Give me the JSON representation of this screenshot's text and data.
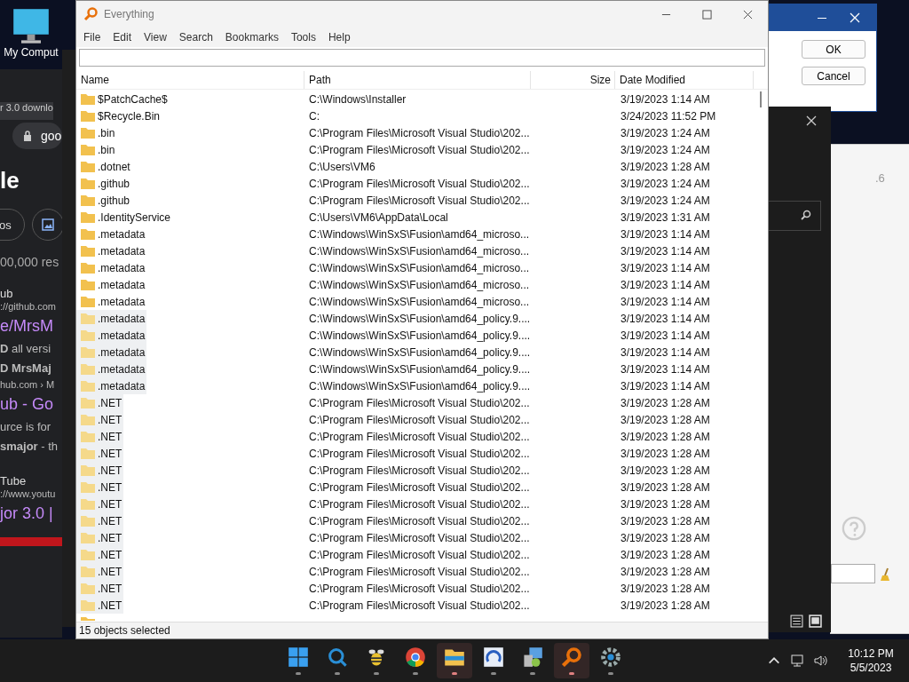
{
  "desktop_icon": {
    "label": "My Comput"
  },
  "browser_lines": [
    {
      "kind": "tab",
      "text": "r 3.0 downlo"
    },
    {
      "kind": "address",
      "text": "goo"
    },
    {
      "kind": "logo",
      "text": "le"
    },
    {
      "kind": "chip",
      "text": "os"
    },
    {
      "kind": "meta",
      "text": "00,000 res"
    },
    {
      "kind": "site",
      "text": "ub"
    },
    {
      "kind": "url",
      "text": "://github.com"
    },
    {
      "kind": "link",
      "text": "e/MrsM"
    },
    {
      "kind": "snippet",
      "text": "**D** all versi"
    },
    {
      "kind": "snippet",
      "text": "**D MrsMaj**"
    },
    {
      "kind": "url",
      "text": "hub.com › M"
    },
    {
      "kind": "link",
      "text": "ub - Go"
    },
    {
      "kind": "snippet",
      "text": "urce is for"
    },
    {
      "kind": "snippet",
      "text": "**smajor** - th"
    },
    {
      "kind": "site",
      "text": "Tube"
    },
    {
      "kind": "url",
      "text": "://www.youtu"
    },
    {
      "kind": "link",
      "text": "jor 3.0 |"
    }
  ],
  "window": {
    "title": "Everything"
  },
  "menu": [
    "File",
    "Edit",
    "View",
    "Search",
    "Bookmarks",
    "Tools",
    "Help"
  ],
  "columns": [
    "Name",
    "Path",
    "Size",
    "Date Modified"
  ],
  "rows": [
    {
      "name": "$PatchCache$",
      "path": "C:\\Windows\\Installer",
      "date": "3/19/2023 1:14 AM",
      "selected": false
    },
    {
      "name": "$Recycle.Bin",
      "path": "C:",
      "date": "3/24/2023 11:52 PM",
      "selected": false
    },
    {
      "name": ".bin",
      "path": "C:\\Program Files\\Microsoft Visual Studio\\202...",
      "date": "3/19/2023 1:24 AM",
      "selected": false
    },
    {
      "name": ".bin",
      "path": "C:\\Program Files\\Microsoft Visual Studio\\202...",
      "date": "3/19/2023 1:24 AM",
      "selected": false
    },
    {
      "name": ".dotnet",
      "path": "C:\\Users\\VM6",
      "date": "3/19/2023 1:28 AM",
      "selected": false
    },
    {
      "name": ".github",
      "path": "C:\\Program Files\\Microsoft Visual Studio\\202...",
      "date": "3/19/2023 1:24 AM",
      "selected": false
    },
    {
      "name": ".github",
      "path": "C:\\Program Files\\Microsoft Visual Studio\\202...",
      "date": "3/19/2023 1:24 AM",
      "selected": false
    },
    {
      "name": ".IdentityService",
      "path": "C:\\Users\\VM6\\AppData\\Local",
      "date": "3/19/2023 1:31 AM",
      "selected": false
    },
    {
      "name": ".metadata",
      "path": "C:\\Windows\\WinSxS\\Fusion\\amd64_microso...",
      "date": "3/19/2023 1:14 AM",
      "selected": false
    },
    {
      "name": ".metadata",
      "path": "C:\\Windows\\WinSxS\\Fusion\\amd64_microso...",
      "date": "3/19/2023 1:14 AM",
      "selected": false
    },
    {
      "name": ".metadata",
      "path": "C:\\Windows\\WinSxS\\Fusion\\amd64_microso...",
      "date": "3/19/2023 1:14 AM",
      "selected": false
    },
    {
      "name": ".metadata",
      "path": "C:\\Windows\\WinSxS\\Fusion\\amd64_microso...",
      "date": "3/19/2023 1:14 AM",
      "selected": false
    },
    {
      "name": ".metadata",
      "path": "C:\\Windows\\WinSxS\\Fusion\\amd64_microso...",
      "date": "3/19/2023 1:14 AM",
      "selected": false
    },
    {
      "name": ".metadata",
      "path": "C:\\Windows\\WinSxS\\Fusion\\amd64_policy.9....",
      "date": "3/19/2023 1:14 AM",
      "selected": true
    },
    {
      "name": ".metadata",
      "path": "C:\\Windows\\WinSxS\\Fusion\\amd64_policy.9....",
      "date": "3/19/2023 1:14 AM",
      "selected": true
    },
    {
      "name": ".metadata",
      "path": "C:\\Windows\\WinSxS\\Fusion\\amd64_policy.9....",
      "date": "3/19/2023 1:14 AM",
      "selected": true
    },
    {
      "name": ".metadata",
      "path": "C:\\Windows\\WinSxS\\Fusion\\amd64_policy.9....",
      "date": "3/19/2023 1:14 AM",
      "selected": true
    },
    {
      "name": ".metadata",
      "path": "C:\\Windows\\WinSxS\\Fusion\\amd64_policy.9....",
      "date": "3/19/2023 1:14 AM",
      "selected": true
    },
    {
      "name": ".NET",
      "path": "C:\\Program Files\\Microsoft Visual Studio\\202...",
      "date": "3/19/2023 1:28 AM",
      "selected": true
    },
    {
      "name": ".NET",
      "path": "C:\\Program Files\\Microsoft Visual Studio\\202...",
      "date": "3/19/2023 1:28 AM",
      "selected": true
    },
    {
      "name": ".NET",
      "path": "C:\\Program Files\\Microsoft Visual Studio\\202...",
      "date": "3/19/2023 1:28 AM",
      "selected": true
    },
    {
      "name": ".NET",
      "path": "C:\\Program Files\\Microsoft Visual Studio\\202...",
      "date": "3/19/2023 1:28 AM",
      "selected": true
    },
    {
      "name": ".NET",
      "path": "C:\\Program Files\\Microsoft Visual Studio\\202...",
      "date": "3/19/2023 1:28 AM",
      "selected": true
    },
    {
      "name": ".NET",
      "path": "C:\\Program Files\\Microsoft Visual Studio\\202...",
      "date": "3/19/2023 1:28 AM",
      "selected": true
    },
    {
      "name": ".NET",
      "path": "C:\\Program Files\\Microsoft Visual Studio\\202...",
      "date": "3/19/2023 1:28 AM",
      "selected": true
    },
    {
      "name": ".NET",
      "path": "C:\\Program Files\\Microsoft Visual Studio\\202...",
      "date": "3/19/2023 1:28 AM",
      "selected": true
    },
    {
      "name": ".NET",
      "path": "C:\\Program Files\\Microsoft Visual Studio\\202...",
      "date": "3/19/2023 1:28 AM",
      "selected": true
    },
    {
      "name": ".NET",
      "path": "C:\\Program Files\\Microsoft Visual Studio\\202...",
      "date": "3/19/2023 1:28 AM",
      "selected": true
    },
    {
      "name": ".NET",
      "path": "C:\\Program Files\\Microsoft Visual Studio\\202...",
      "date": "3/19/2023 1:28 AM",
      "selected": true
    },
    {
      "name": ".NET",
      "path": "C:\\Program Files\\Microsoft Visual Studio\\202...",
      "date": "3/19/2023 1:28 AM",
      "selected": true
    },
    {
      "name": ".NET",
      "path": "C:\\Program Files\\Microsoft Visual Studio\\202...",
      "date": "3/19/2023 1:28 AM",
      "selected": true
    }
  ],
  "status_bar": "15 objects selected",
  "dialog": {
    "buttons": [
      "OK",
      "Cancel"
    ]
  },
  "side_window": {
    "version": ".6"
  },
  "taskbar": {
    "apps": [
      {
        "kind": "start",
        "active": false
      },
      {
        "kind": "search",
        "active": false
      },
      {
        "kind": "bee",
        "active": false
      },
      {
        "kind": "chrome",
        "active": false
      },
      {
        "kind": "folder",
        "active": true
      },
      {
        "kind": "cloud",
        "active": false
      },
      {
        "kind": "panel",
        "active": false
      },
      {
        "kind": "everything",
        "active": true
      },
      {
        "kind": "gear",
        "active": false
      }
    ],
    "time": "10:12 PM",
    "date": "5/5/2023"
  }
}
